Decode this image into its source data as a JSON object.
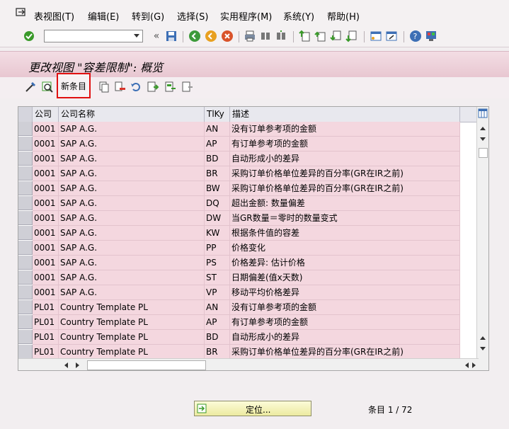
{
  "menu": [
    "表视图(T)",
    "编辑(E)",
    "转到(G)",
    "选择(S)",
    "实用程序(M)",
    "系统(Y)",
    "帮助(H)"
  ],
  "title": "更改视图 \"容差限制\": 概览",
  "toolbar2": {
    "new_entry_label": "新条目"
  },
  "table": {
    "columns": [
      "公司",
      "公司名称",
      "TlKy",
      "描述"
    ],
    "rows": [
      [
        "0001",
        "SAP A.G.",
        "AN",
        "没有订单参考项的金额"
      ],
      [
        "0001",
        "SAP A.G.",
        "AP",
        "有订单参考项的金额"
      ],
      [
        "0001",
        "SAP A.G.",
        "BD",
        "自动形成小的差异"
      ],
      [
        "0001",
        "SAP A.G.",
        "BR",
        "采购订单价格单位差异的百分率(GR在IR之前)"
      ],
      [
        "0001",
        "SAP A.G.",
        "BW",
        "采购订单价格单位差异的百分率(GR在IR之前)"
      ],
      [
        "0001",
        "SAP A.G.",
        "DQ",
        "超出金额: 数量偏差"
      ],
      [
        "0001",
        "SAP A.G.",
        "DW",
        "当GR数量＝零时的数量变式"
      ],
      [
        "0001",
        "SAP A.G.",
        "KW",
        "根据条件值的容差"
      ],
      [
        "0001",
        "SAP A.G.",
        "PP",
        "价格变化"
      ],
      [
        "0001",
        "SAP A.G.",
        "PS",
        "价格差异: 估计价格"
      ],
      [
        "0001",
        "SAP A.G.",
        "ST",
        "日期偏差(值x天数)"
      ],
      [
        "0001",
        "SAP A.G.",
        "VP",
        "移动平均价格差异"
      ],
      [
        "PL01",
        "Country Template PL",
        "AN",
        "没有订单参考项的金额"
      ],
      [
        "PL01",
        "Country Template PL",
        "AP",
        "有订单参考项的金额"
      ],
      [
        "PL01",
        "Country Template PL",
        "BD",
        "自动形成小的差异"
      ],
      [
        "PL01",
        "Country Template PL",
        "BR",
        "采购订单价格单位差异的百分率(GR在IR之前)"
      ]
    ]
  },
  "footer": {
    "locate_label": "定位...",
    "entries_text": "条目 1 / 72"
  }
}
